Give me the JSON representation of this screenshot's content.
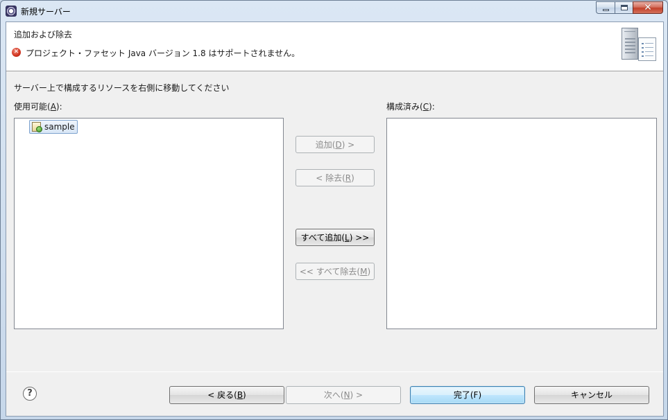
{
  "window": {
    "title": "新規サーバー"
  },
  "header": {
    "title": "追加および除去",
    "error_message": "プロジェクト・ファセット Java バージョン 1.8 はサポートされません。"
  },
  "body": {
    "instruction": "サーバー上で構成するリソースを右側に移動してください",
    "available_label": {
      "prefix": "使用可能(",
      "mnemonic": "A",
      "suffix": "):"
    },
    "configured_label": {
      "prefix": "構成済み(",
      "mnemonic": "C",
      "suffix": "):"
    },
    "available_items": [
      "sample"
    ],
    "configured_items": []
  },
  "middle_buttons": {
    "add": {
      "prefix": "追加(",
      "mnemonic": "D",
      "suffix": ") >"
    },
    "remove": {
      "prefix": "< 除去(",
      "mnemonic": "R",
      "suffix": ")"
    },
    "add_all": {
      "prefix": "すべて追加(",
      "mnemonic": "L",
      "suffix": ") >>"
    },
    "remove_all": {
      "prefix": "<< すべて除去(",
      "mnemonic": "M",
      "suffix": ")"
    }
  },
  "footer": {
    "help_glyph": "?",
    "back": {
      "prefix": "< 戻る(",
      "mnemonic": "B",
      "suffix": ")"
    },
    "next": {
      "prefix": "次へ(",
      "mnemonic": "N",
      "suffix": ") >"
    },
    "finish": "完了(F)",
    "cancel": "キャンセル"
  },
  "window_controls": {
    "close_glyph": "✕"
  },
  "colors": {
    "error": "#d0321d",
    "selection_border": "#7da2ce",
    "focus_border": "#3c7fb1"
  },
  "icons": [
    "app-icon",
    "minimize-icon",
    "maximize-icon",
    "close-icon",
    "error-icon",
    "server-graphic-icon",
    "project-icon",
    "help-icon"
  ]
}
